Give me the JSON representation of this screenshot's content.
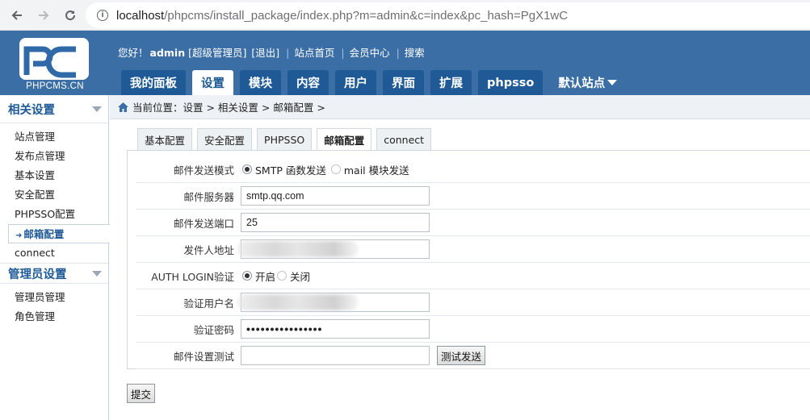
{
  "browser": {
    "url_host": "localhost",
    "url_path": "/phpcms/install_package/index.php?m=admin&c=index&pc_hash=PgX1wC",
    "back_icon": "arrow-left",
    "forward_icon": "arrow-right",
    "reload_icon": "reload",
    "info_icon": "info"
  },
  "header": {
    "logo_text": "PHPCMS.CN",
    "greeting": "您好！",
    "username": "admin",
    "role": "[超级管理员]",
    "logout": "[退出]",
    "site_home": "站点首页",
    "member_center": "会员中心",
    "search": "搜索",
    "tabs": [
      "我的面板",
      "设置",
      "模块",
      "内容",
      "用户",
      "界面",
      "扩展",
      "phpsso"
    ],
    "active_tab": "设置",
    "site_select": "默认站点"
  },
  "sidebar": {
    "group1_title": "相关设置",
    "group1_items": [
      "站点管理",
      "发布点管理",
      "基本设置",
      "安全配置",
      "PHPSSO配置",
      "邮箱配置",
      "connect"
    ],
    "active_item": "邮箱配置",
    "group2_title": "管理员设置",
    "group2_items": [
      "管理员管理",
      "角色管理"
    ]
  },
  "breadcrumb": {
    "prefix": "当前位置：",
    "path": "设置 > 相关设置 > 邮箱配置 >"
  },
  "subtabs": [
    "基本配置",
    "安全配置",
    "PHPSSO",
    "邮箱配置",
    "connect"
  ],
  "active_subtab": "邮箱配置",
  "form": {
    "mail_mode_label": "邮件发送模式",
    "mail_mode_smtp": "SMTP 函数发送",
    "mail_mode_mail": "mail 模块发送",
    "mail_mode_value": "SMTP 函数发送",
    "server_label": "邮件服务器",
    "server_value": "smtp.qq.com",
    "port_label": "邮件发送端口",
    "port_value": "25",
    "from_label": "发件人地址",
    "auth_label": "AUTH LOGIN验证",
    "auth_on": "开启",
    "auth_off": "关闭",
    "auth_value": "开启",
    "user_label": "验证用户名",
    "password_label": "验证密码",
    "password_value": "••••••••••••••••",
    "test_label": "邮件设置测试",
    "test_value": "",
    "test_button": "测试发送"
  },
  "submit_button": "提交",
  "colors": {
    "header_blue": "#3a6ea5",
    "tab_blue": "#1f5a96"
  }
}
